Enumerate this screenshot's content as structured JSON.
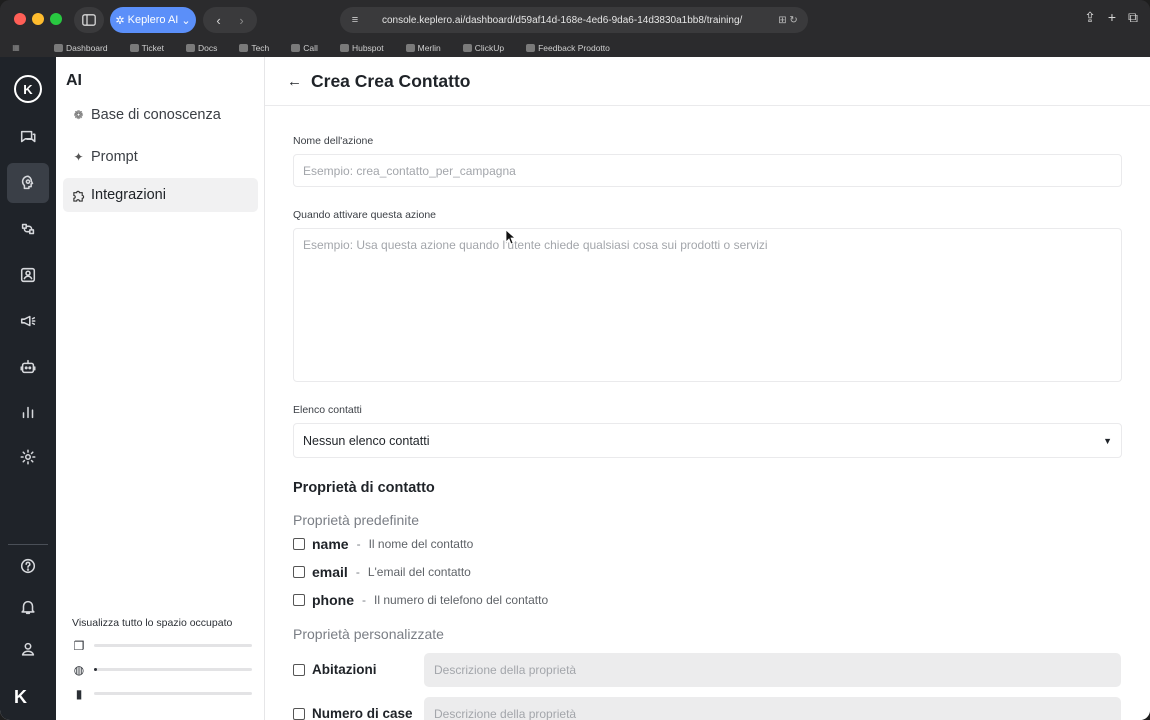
{
  "browser": {
    "profile_label": "Keplero AI",
    "url": "console.keplero.ai/dashboard/d59af14d-168e-4ed6-9da6-14d3830a1bb8/training/",
    "bookmarks": [
      "Dashboard",
      "Ticket",
      "Docs",
      "Tech",
      "Call",
      "Hubspot",
      "Merlin",
      "ClickUp",
      "Feedback Prodotto"
    ]
  },
  "rail": {
    "logo_text": "K",
    "items": [
      "chat-icon",
      "training-icon",
      "integrations-icon",
      "contacts-icon",
      "campaigns-icon",
      "bot-icon",
      "analytics-icon",
      "settings-icon"
    ],
    "bottom_items": [
      "help-icon",
      "bell-icon",
      "user-icon"
    ]
  },
  "subnav": {
    "title": "AI",
    "items": [
      {
        "label": "Base di conoscenza",
        "icon": "brain-icon"
      },
      {
        "label": "Prompt",
        "icon": "sparkle-icon"
      },
      {
        "label": "Integrazioni",
        "icon": "puzzle-icon"
      }
    ],
    "storage_label": "Visualizza tutto lo spazio occupato",
    "storage_levels": [
      0.0,
      0.02,
      0.0
    ]
  },
  "main": {
    "title": "Crea Crea Contatto",
    "action_name_label": "Nome dell'azione",
    "action_name_placeholder": "Esempio: crea_contatto_per_campagna",
    "trigger_label": "Quando attivare questa azione",
    "trigger_placeholder": "Esempio: Usa questa azione quando l'utente chiede qualsiasi cosa sui prodotti o servizi",
    "list_label": "Elenco contatti",
    "list_value": "Nessun elenco contatti",
    "properties_title": "Proprietà di contatto",
    "default_title": "Proprietà predefinite",
    "default_props": [
      {
        "name": "name",
        "desc": "Il nome del contatto"
      },
      {
        "name": "email",
        "desc": "L'email del contatto"
      },
      {
        "name": "phone",
        "desc": "Il numero di telefono del contatto"
      }
    ],
    "custom_title": "Proprietà personalizzate",
    "custom_props": [
      {
        "name": "Abitazioni",
        "placeholder": "Descrizione della proprietà"
      },
      {
        "name": "Numero di case",
        "placeholder": "Descrizione della proprietà"
      }
    ],
    "dash": "-"
  }
}
